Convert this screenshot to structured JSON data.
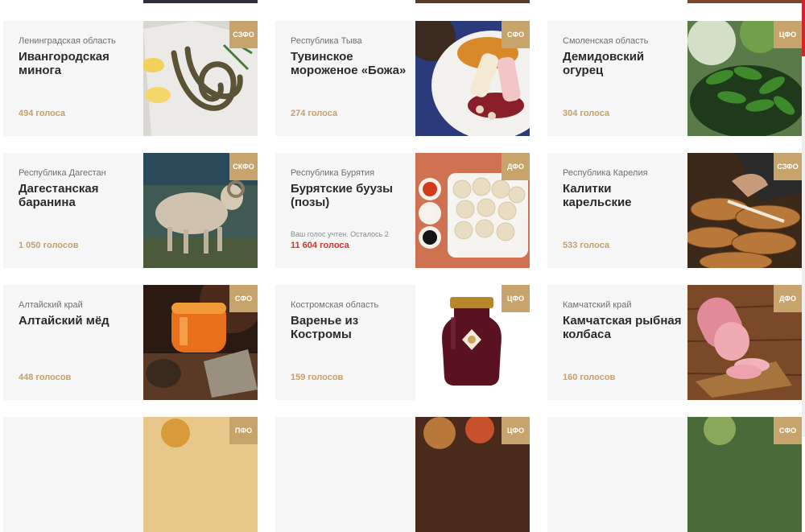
{
  "page": {
    "background": "#ffffff",
    "accent": "#c4a06b",
    "voted_color": "#d0342c"
  },
  "cards": [
    {
      "region": "Ленинградская область",
      "title": "Ивангородская минога",
      "votes": "494 голоса",
      "district": "СЗФО",
      "photo": "lamprey-photo"
    },
    {
      "region": "Республика Тыва",
      "title": "Тувинское мороженое «Божа»",
      "votes": "274 голоса",
      "district": "СФО",
      "photo": "ice-cream-photo"
    },
    {
      "region": "Смоленская область",
      "title": "Демидовский огурец",
      "votes": "304 голоса",
      "district": "ЦФО",
      "photo": "cucumber-photo"
    },
    {
      "region": "Республика Дагестан",
      "title": "Дагестанская баранина",
      "votes": "1 050 голосов",
      "district": "СКФО",
      "photo": "ram-photo"
    },
    {
      "region": "Республика Бурятия",
      "title": "Бурятские буузы (позы)",
      "note": "Ваш голос учтен. Осталось 2",
      "votes": "11 604 голоса",
      "district": "ДФО",
      "photo": "buuzy-photo",
      "voted": true
    },
    {
      "region": "Республика Карелия",
      "title": "Калитки карельские",
      "votes": "533 голоса",
      "district": "СЗФО",
      "photo": "kalitki-photo"
    },
    {
      "region": "Алтайский край",
      "title": "Алтайский мёд",
      "votes": "448 голосов",
      "district": "СФО",
      "photo": "honey-photo"
    },
    {
      "region": "Костромская область",
      "title": "Варенье из Костромы",
      "votes": "159 голосов",
      "district": "ЦФО",
      "photo": "jam-jar-photo"
    },
    {
      "region": "Камчатский край",
      "title": "Камчатская рыбная колбаса",
      "votes": "160 голосов",
      "district": "ДФО",
      "photo": "fish-sausage-photo"
    },
    {
      "district": "ПФО",
      "photo": "partial-photo"
    },
    {
      "district": "ЦФО",
      "photo": "partial-photo"
    },
    {
      "district": "СФО",
      "photo": "partial-photo"
    }
  ]
}
